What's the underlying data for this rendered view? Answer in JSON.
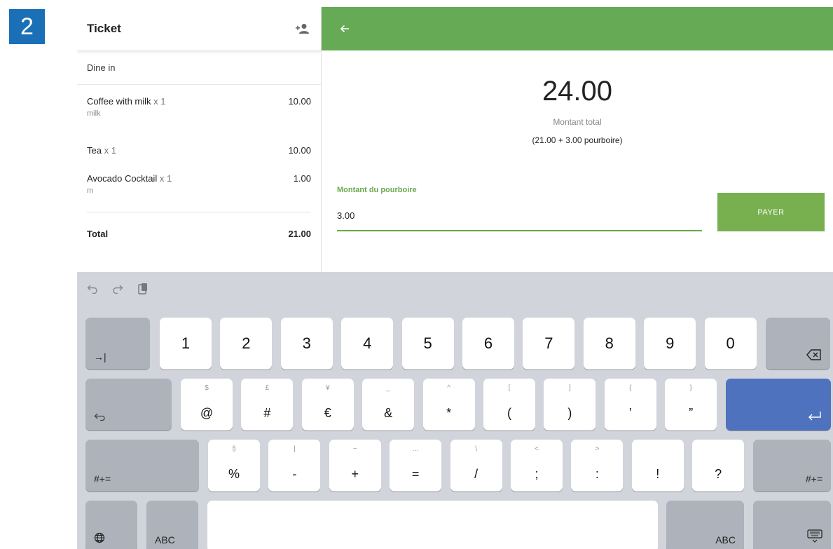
{
  "step_badge": "2",
  "ticket": {
    "title": "Ticket",
    "dine_option": "Dine in",
    "items": [
      {
        "name": "Coffee with milk",
        "qty": "x 1",
        "price": "10.00",
        "modifier": "milk"
      },
      {
        "name": "Tea",
        "qty": "x 1",
        "price": "10.00",
        "modifier": ""
      },
      {
        "name": "Avocado Cocktail",
        "qty": "x 1",
        "price": "1.00",
        "modifier": "m"
      }
    ],
    "total_label": "Total",
    "total_value": "21.00"
  },
  "payment": {
    "amount": "24.00",
    "amount_label": "Montant total",
    "breakdown": "(21.00 + 3.00 pourboire)",
    "tip_label": "Montant du pourboire",
    "tip_value": "3.00",
    "pay_label": "PAYER"
  },
  "keyboard": {
    "row1": [
      "1",
      "2",
      "3",
      "4",
      "5",
      "6",
      "7",
      "8",
      "9",
      "0"
    ],
    "row2": [
      {
        "alt": "$",
        "main": "@"
      },
      {
        "alt": "£",
        "main": "#"
      },
      {
        "alt": "¥",
        "main": "€"
      },
      {
        "alt": "_",
        "main": "&"
      },
      {
        "alt": "^",
        "main": "*"
      },
      {
        "alt": "[",
        "main": "("
      },
      {
        "alt": "]",
        "main": ")"
      },
      {
        "alt": "{",
        "main": "’"
      },
      {
        "alt": "}",
        "main": "”"
      }
    ],
    "row3": [
      {
        "alt": "§",
        "main": "%"
      },
      {
        "alt": "|",
        "main": "-"
      },
      {
        "alt": "~",
        "main": "+"
      },
      {
        "alt": "…",
        "main": "="
      },
      {
        "alt": "\\",
        "main": "/"
      },
      {
        "alt": "<",
        "main": ";"
      },
      {
        "alt": ">",
        "main": ":"
      },
      {
        "alt": "",
        "main": "!"
      },
      {
        "alt": "",
        "main": "?"
      }
    ],
    "symbols_label": "#+=",
    "abc_label": "ABC",
    "colors": {
      "accent": "#66aa55",
      "pay": "#78b04f",
      "return": "#4f72be",
      "badge": "#1a6fb7"
    }
  }
}
